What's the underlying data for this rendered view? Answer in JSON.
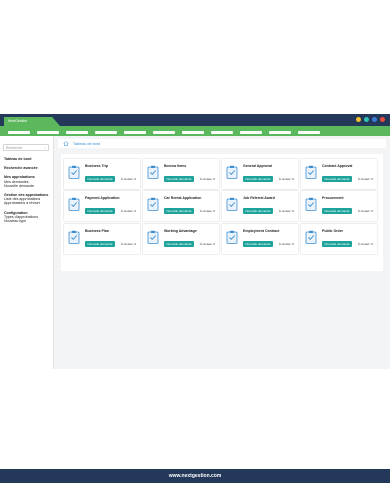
{
  "window": {
    "tab_label": "NextGestion",
    "controls": [
      {
        "name": "yellow",
        "color": "#f2c12e"
      },
      {
        "name": "teal",
        "color": "#2ec4b6"
      },
      {
        "name": "blue",
        "color": "#3a7bd5"
      },
      {
        "name": "red",
        "color": "#e74c3c"
      }
    ]
  },
  "colors": {
    "navbar": "#5cb85c",
    "titlebar": "#24385a",
    "button": "#1ea39a",
    "icon": "#3b8ed0"
  },
  "sidebar": {
    "search_placeholder": "Rechercher",
    "items": [
      {
        "label": "Tableau de bord",
        "heading": true
      },
      {
        "label": "Recherche avancée",
        "heading": true
      },
      {
        "label": "Mes approbations",
        "heading": true
      },
      {
        "label": "Mes demandes",
        "heading": false
      },
      {
        "label": "Nouvelle demande",
        "heading": false
      },
      {
        "label": "Gestion des approbations",
        "heading": true
      },
      {
        "label": "Liste des approbations",
        "heading": false
      },
      {
        "label": "Approbations à réviser",
        "heading": false
      },
      {
        "label": "Configuration",
        "heading": true
      },
      {
        "label": "Types d'approbations",
        "heading": false
      },
      {
        "label": "Nouveau type",
        "heading": false
      }
    ]
  },
  "breadcrumb": {
    "icon": "home-icon",
    "label": "Tableau de bord"
  },
  "cards": [
    {
      "title": "Business Trip",
      "icon": "suitcase-icon",
      "button": "Nouvelle demande",
      "review": "À réviser: 0"
    },
    {
      "title": "Borrow Items",
      "icon": "box-icon",
      "button": "Nouvelle demande",
      "review": "À réviser: 0"
    },
    {
      "title": "General Approval",
      "icon": "check-icon",
      "button": "Nouvelle demande",
      "review": "À réviser: 0"
    },
    {
      "title": "Contract Approval",
      "icon": "document-icon",
      "button": "Nouvelle demande",
      "review": "À réviser: 0"
    },
    {
      "title": "Payment Application",
      "icon": "card-icon",
      "button": "Nouvelle demande",
      "review": "À réviser: 0"
    },
    {
      "title": "Car Rental Application",
      "icon": "car-icon",
      "button": "Nouvelle demande",
      "review": "À réviser: 0"
    },
    {
      "title": "Job Referral Award",
      "icon": "user-icon",
      "button": "Nouvelle demande",
      "review": "À réviser: 0"
    },
    {
      "title": "Procurement",
      "icon": "cart-icon",
      "button": "Nouvelle demande",
      "review": "À réviser: 0"
    },
    {
      "title": "Business Plan",
      "icon": "chart-icon",
      "button": "Nouvelle demande",
      "review": "À réviser: 0"
    },
    {
      "title": "Working Advantage",
      "icon": "briefcase-icon",
      "button": "Nouvelle demande",
      "review": "À réviser: 0"
    },
    {
      "title": "Employment Contract",
      "icon": "contract-icon",
      "button": "Nouvelle demande",
      "review": "À réviser: 0"
    },
    {
      "title": "Public Order",
      "icon": "list-icon",
      "button": "Nouvelle demande",
      "review": "À réviser: 0"
    }
  ],
  "footer": {
    "text": "www.nextgestion.com"
  }
}
